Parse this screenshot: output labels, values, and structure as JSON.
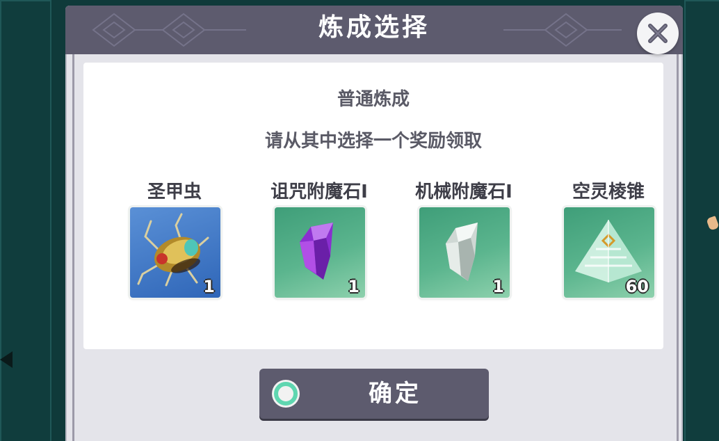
{
  "dialog": {
    "title": "炼成选择",
    "close_icon": "close-icon"
  },
  "content": {
    "subtitle": "普通炼成",
    "instruction": "请从其中选择一个奖励领取"
  },
  "rewards": [
    {
      "name": "圣甲虫",
      "count": "1",
      "icon": "scarab-icon",
      "slot_color": "#2f66b8"
    },
    {
      "name": "诅咒附魔石I",
      "count": "1",
      "icon": "purple-crystal-icon",
      "slot_color": "#3f9e79"
    },
    {
      "name": "机械附魔石I",
      "count": "1",
      "icon": "white-crystal-icon",
      "slot_color": "#3f9e79"
    },
    {
      "name": "空灵棱锥",
      "count": "60",
      "icon": "pyramid-icon",
      "slot_color": "#3f9e79"
    }
  ],
  "confirm": {
    "label": "确定",
    "ring_icon": "circle-ring-icon",
    "ring_color": "#5fd6b0"
  },
  "colors": {
    "header": "#5d5b6e",
    "panel": "#e4e4ea",
    "background": "#0f3a3a"
  }
}
